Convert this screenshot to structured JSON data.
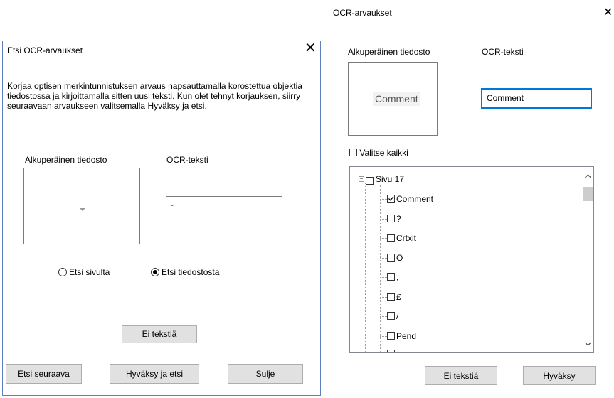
{
  "left_dialog": {
    "title": "Etsi OCR-arvaukset",
    "close": "✕",
    "description": "Korjaa optisen merkintunnistuksen arvaus napsauttamalla korostettua objektia tiedostossa ja kirjoittamalla sitten uusi teksti. Kun olet tehnyt korjauksen, siirry seuraavaan arvaukseen valitsemalla Hyväksy ja etsi.",
    "original_label": "Alkuperäinen tiedosto",
    "ocr_label": "OCR-teksti",
    "ocr_value": "-",
    "radio_page": "Etsi sivulta",
    "radio_document": "Etsi tiedostosta",
    "radio_selected": "document",
    "btn_no_text": "Ei tekstiä",
    "btn_find_next": "Etsi seuraava",
    "btn_accept_find": "Hyväksy ja etsi",
    "btn_close": "Sulje"
  },
  "right_dialog": {
    "title": "OCR-arvaukset",
    "close": "✕",
    "original_label": "Alkuperäinen tiedosto",
    "ocr_label": "OCR-teksti",
    "preview_word": "Comment",
    "ocr_value": "Comment",
    "select_all": "Valitse kaikki",
    "tree_root": "Sivu 17",
    "tree_items": [
      {
        "label": "Comment",
        "checked": true
      },
      {
        "label": "?",
        "checked": false
      },
      {
        "label": "Crtxit",
        "checked": false
      },
      {
        "label": "O",
        "checked": false
      },
      {
        "label": ",",
        "checked": false
      },
      {
        "label": "£",
        "checked": false
      },
      {
        "label": "/",
        "checked": false
      },
      {
        "label": "Pend",
        "checked": false
      }
    ],
    "btn_no_text": "Ei tekstiä",
    "btn_accept": "Hyväksy"
  },
  "colors": {
    "dialog_border": "#5c7fbf",
    "focus_border": "#0078d7",
    "button_bg": "#e1e1e1"
  }
}
